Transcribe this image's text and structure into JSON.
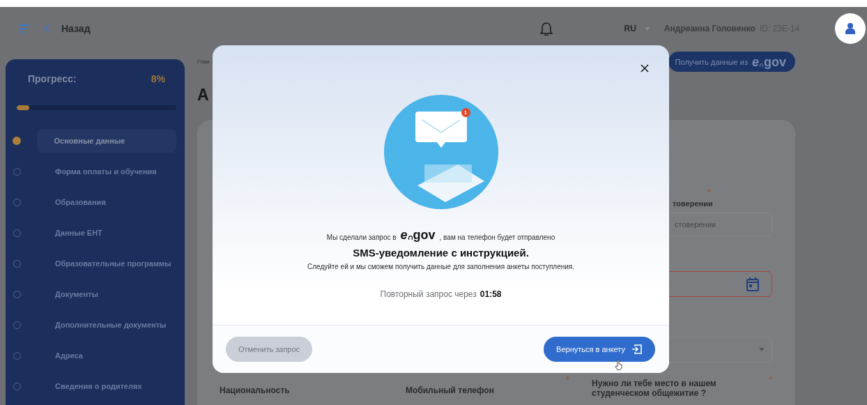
{
  "header": {
    "back_label": "Назад",
    "language": "RU",
    "user_name": "Андреанна Головенко",
    "user_id": "ID: 23E-14"
  },
  "sidebar": {
    "progress_label": "Прогресс:",
    "progress_value": "8%",
    "level": 0.08,
    "items": [
      {
        "label": "Основные данные",
        "selected": true
      },
      {
        "label": "Форма оплаты и обучения",
        "selected": false
      },
      {
        "label": "Образования",
        "selected": false
      },
      {
        "label": "Данные ЕНТ",
        "selected": false
      },
      {
        "label": "Образовательные программы",
        "selected": false
      },
      {
        "label": "Документы",
        "selected": false
      },
      {
        "label": "Дополнительные документы",
        "selected": false
      },
      {
        "label": "Адреса",
        "selected": false
      },
      {
        "label": "Сведения о родителях",
        "selected": false
      }
    ]
  },
  "main": {
    "breadcrumb": "Глав",
    "title": "А",
    "egov_button": {
      "label": "Получить данные из",
      "logo_prefix": "e",
      "logo_suffix": "gov"
    },
    "form": {
      "id_required_mark": "*",
      "id_label": "товерении",
      "id_placeholder": "стоверении",
      "date_error": true,
      "bottom_fields": [
        {
          "label": "Национальность"
        },
        {
          "label": "Мобильный телефон",
          "required_mark": "*"
        },
        {
          "label": "Нужно ли тебе место в нашем студенческом общежитие ?",
          "required_mark": "*"
        }
      ]
    }
  },
  "modal": {
    "badge": "1",
    "message_before": "Мы сделали запрос в",
    "logo_prefix": "e",
    "logo_suffix": "gov",
    "message_after": ", вам на телефон будет отправлено",
    "heading": "SMS-уведомление с инструкцией.",
    "instruction": "Следуйте ей и мы сможем получить данные для заполнения анкеты поступления.",
    "retry_label": "Повторный запрос через",
    "retry_time": "01:58",
    "cancel_button": "Отменить запрос",
    "return_button": "Вернуться в анкету"
  }
}
